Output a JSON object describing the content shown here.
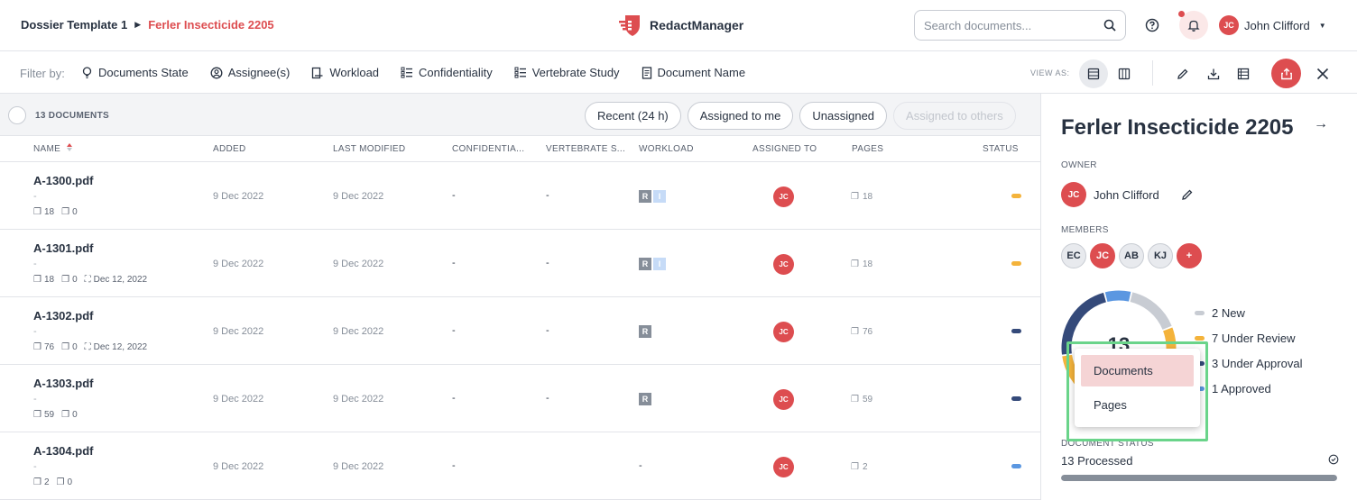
{
  "header": {
    "breadcrumb_root": "Dossier Template 1",
    "breadcrumb_current": "Ferler Insecticide 2205",
    "brand": "RedactManager",
    "search_placeholder": "Search documents...",
    "user_initials": "JC",
    "user_name": "John Clifford"
  },
  "filterbar": {
    "label": "Filter by:",
    "filters": [
      "Documents State",
      "Assignee(s)",
      "Workload",
      "Confidentiality",
      "Vertebrate Study",
      "Document Name"
    ],
    "view_as": "VIEW AS:"
  },
  "table": {
    "count": "13 DOCUMENTS",
    "quick_filters": [
      "Recent (24 h)",
      "Assigned to me",
      "Unassigned",
      "Assigned to others"
    ],
    "columns": [
      "NAME",
      "ADDED",
      "LAST MODIFIED",
      "CONFIDENTIA...",
      "VERTEBRATE S...",
      "WORKLOAD",
      "ASSIGNED TO",
      "PAGES",
      "STATUS"
    ],
    "rows": [
      {
        "name": "A-1300.pdf",
        "dash": "-",
        "pages_meta": "18",
        "annot": "0",
        "date_meta": "",
        "added": "9 Dec 2022",
        "modified": "9 Dec 2022",
        "conf": "-",
        "vert": "-",
        "workload_r": "R",
        "workload_i": "I",
        "assignee": "JC",
        "pages": "18",
        "status_color": "#f4b33b"
      },
      {
        "name": "A-1301.pdf",
        "dash": "-",
        "pages_meta": "18",
        "annot": "0",
        "date_meta": "Dec 12, 2022",
        "added": "9 Dec 2022",
        "modified": "9 Dec 2022",
        "conf": "-",
        "vert": "-",
        "workload_r": "R",
        "workload_i": "I",
        "assignee": "JC",
        "pages": "18",
        "status_color": "#f4b33b"
      },
      {
        "name": "A-1302.pdf",
        "dash": "-",
        "pages_meta": "76",
        "annot": "0",
        "date_meta": "Dec 12, 2022",
        "added": "9 Dec 2022",
        "modified": "9 Dec 2022",
        "conf": "-",
        "vert": "-",
        "workload_r": "R",
        "workload_i": "",
        "assignee": "JC",
        "pages": "76",
        "status_color": "#354a7a"
      },
      {
        "name": "A-1303.pdf",
        "dash": "-",
        "pages_meta": "59",
        "annot": "0",
        "date_meta": "",
        "added": "9 Dec 2022",
        "modified": "9 Dec 2022",
        "conf": "-",
        "vert": "-",
        "workload_r": "R",
        "workload_i": "",
        "assignee": "JC",
        "pages": "59",
        "status_color": "#354a7a"
      },
      {
        "name": "A-1304.pdf",
        "dash": "-",
        "pages_meta": "2",
        "annot": "0",
        "date_meta": "",
        "added": "9 Dec 2022",
        "modified": "9 Dec 2022",
        "conf": "-",
        "vert": "-",
        "workload_r": "",
        "workload_i": "",
        "assignee": "JC",
        "pages": "2",
        "status_color": "#5b97e1"
      }
    ]
  },
  "panel": {
    "title": "Ferler Insecticide 2205",
    "owner_label": "OWNER",
    "owner_initials": "JC",
    "owner_name": "John Clifford",
    "members_label": "MEMBERS",
    "members": [
      "EC",
      "JC",
      "AB",
      "KJ",
      "+"
    ],
    "donut_total": "13",
    "legend": [
      {
        "label": "2 New",
        "color": "#c8ccd3"
      },
      {
        "label": "7 Under Review",
        "color": "#f4b33b"
      },
      {
        "label": "3 Under Approval",
        "color": "#354a7a"
      },
      {
        "label": "1 Approved",
        "color": "#5b97e1"
      }
    ],
    "dropdown": [
      "Documents",
      "Pages"
    ],
    "doc_status_label": "DOCUMENT STATUS",
    "processed": "13 Processed",
    "processed_fraction": 1.0
  }
}
